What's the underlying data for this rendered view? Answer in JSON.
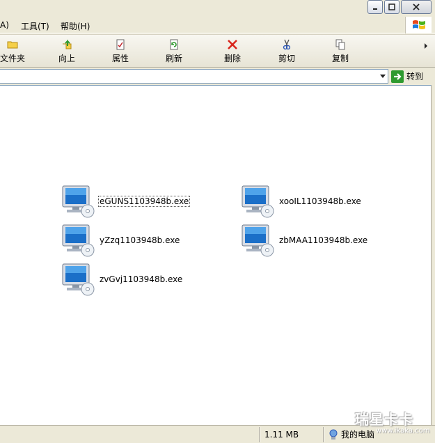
{
  "menu": {
    "items": [
      {
        "label": "A)"
      },
      {
        "label": "工具(T)"
      },
      {
        "label": "帮助(H)"
      }
    ]
  },
  "toolbar": {
    "buttons": [
      {
        "label": "文件夹",
        "icon": "folder-icon"
      },
      {
        "label": "向上",
        "icon": "up-folder-icon"
      },
      {
        "label": "属性",
        "icon": "properties-icon"
      },
      {
        "label": "刷新",
        "icon": "refresh-icon"
      },
      {
        "label": "删除",
        "icon": "delete-icon"
      },
      {
        "label": "剪切",
        "icon": "cut-icon"
      },
      {
        "label": "复制",
        "icon": "copy-icon"
      }
    ]
  },
  "address": {
    "value": "",
    "go_label": "转到"
  },
  "files": [
    {
      "name": "eGUNS1103948b.exe"
    },
    {
      "name": "xooIL1103948b.exe"
    },
    {
      "name": "yZzq1103948b.exe"
    },
    {
      "name": "zbMAA1103948b.exe"
    },
    {
      "name": "zvGvj1103948b.exe"
    }
  ],
  "status": {
    "size": "1.11 MB",
    "location": "我的电脑"
  },
  "watermark": {
    "text": "瑞星卡卡",
    "url": "www.ikaka.com"
  },
  "colors": {
    "delete_red": "#d9261c",
    "go_green": "#2e9a2e",
    "window_bg": "#ece9d8"
  }
}
